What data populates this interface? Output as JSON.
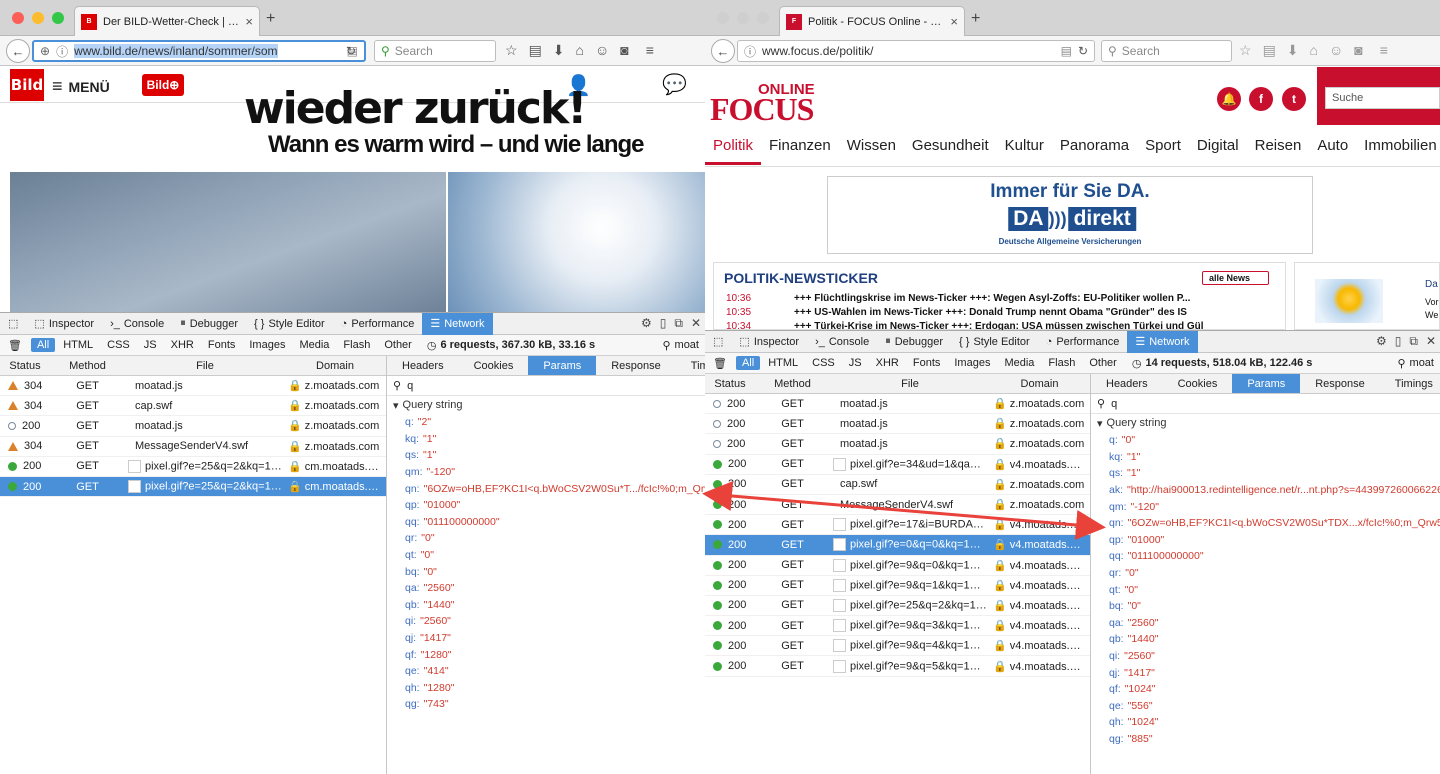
{
  "left": {
    "tab_title": "Der BILD-Wetter-Check | D...",
    "url": "www.bild.de/news/inland/sommer/som",
    "search_placeholder": "Search",
    "menu_label": "MENÜ",
    "logo": "Bild",
    "headline_cut": "wieder zurück!",
    "subheadline": "Wann es warm wird – und wie lange",
    "devtools": {
      "tabs": [
        "Inspector",
        "Console",
        "Debugger",
        "Style Editor",
        "Performance",
        "Network"
      ],
      "filters": [
        "All",
        "HTML",
        "CSS",
        "JS",
        "XHR",
        "Fonts",
        "Images",
        "Media",
        "Flash",
        "Other"
      ],
      "summary": "6 requests, 367.30 kB, 33.16 s",
      "filter_value": "moat",
      "headers": [
        "Status",
        "Method",
        "File",
        "Domain"
      ],
      "rows": [
        {
          "ind": "warn",
          "status": "304",
          "method": "GET",
          "file": "moatad.js",
          "domain": "z.moatads.com",
          "thumb": false
        },
        {
          "ind": "warn",
          "status": "304",
          "method": "GET",
          "file": "cap.swf",
          "domain": "z.moatads.com",
          "thumb": false
        },
        {
          "ind": "empty",
          "status": "200",
          "method": "GET",
          "file": "moatad.js",
          "domain": "z.moatads.com",
          "thumb": false
        },
        {
          "ind": "warn",
          "status": "304",
          "method": "GET",
          "file": "MessageSenderV4.swf",
          "domain": "z.moatads.com",
          "thumb": false
        },
        {
          "ind": "ok",
          "status": "200",
          "method": "GET",
          "file": "pixel.gif?e=25&q=2&kq=1&...",
          "domain": "cm.moatads.c...",
          "thumb": true
        },
        {
          "ind": "ok",
          "status": "200",
          "method": "GET",
          "file": "pixel.gif?e=25&q=2&kq=1&...",
          "domain": "cm.moatads.c...",
          "thumb": true,
          "selected": true
        }
      ],
      "side_tabs": [
        "Headers",
        "Cookies",
        "Params",
        "Response",
        "Timi"
      ],
      "param_filter": "q",
      "query_string_label": "Query string",
      "params": [
        {
          "k": "q:",
          "v": "\"2\""
        },
        {
          "k": "kq:",
          "v": "\"1\""
        },
        {
          "k": "qs:",
          "v": "\"1\""
        },
        {
          "k": "qm:",
          "v": "\"-120\""
        },
        {
          "k": "qn:",
          "v": "\"6OZw=oHB,EF?KC1I<q.bWoCSV2W0Su*T.../fcIc!%0;m_Qrw5.W/"
        },
        {
          "k": "qp:",
          "v": "\"01000\""
        },
        {
          "k": "qq:",
          "v": "\"011100000000\""
        },
        {
          "k": "qr:",
          "v": "\"0\""
        },
        {
          "k": "qt:",
          "v": "\"0\""
        },
        {
          "k": "bq:",
          "v": "\"0\""
        },
        {
          "k": "qa:",
          "v": "\"2560\""
        },
        {
          "k": "qb:",
          "v": "\"1440\""
        },
        {
          "k": "qi:",
          "v": "\"2560\""
        },
        {
          "k": "qj:",
          "v": "\"1417\""
        },
        {
          "k": "qf:",
          "v": "\"1280\""
        },
        {
          "k": "qe:",
          "v": "\"414\""
        },
        {
          "k": "qh:",
          "v": "\"1280\""
        },
        {
          "k": "qg:",
          "v": "\"743\""
        }
      ]
    }
  },
  "right": {
    "tab_title": "Politik - FOCUS Online - Na...",
    "url": "www.focus.de/politik/",
    "search_placeholder": "Search",
    "logo_online": "ONLINE",
    "logo_focus": "FOCUS",
    "suche": "Suche",
    "nav": [
      "Politik",
      "Finanzen",
      "Wissen",
      "Gesundheit",
      "Kultur",
      "Panorama",
      "Sport",
      "Digital",
      "Reisen",
      "Auto",
      "Immobilien"
    ],
    "ad": {
      "line1": "Immer für Sie DA.",
      "brand1": "DA",
      "brand2": "direkt",
      "line3": "Deutsche Allgemeine Versicherungen"
    },
    "newsticker": {
      "title": "POLITIK-NEWSTICKER",
      "all_news": "alle News",
      "items": [
        {
          "time": "10:36",
          "text": "+++ Flüchtlingskrise im News-Ticker +++: Wegen Asyl-Zoffs: EU-Politiker wollen P..."
        },
        {
          "time": "10:35",
          "text": "+++ US-Wahlen im News-Ticker +++: Donald Trump nennt Obama \"Gründer\" des IS"
        },
        {
          "time": "10:34",
          "text": "+++ Türkei-Krise im News-Ticker +++: Erdogan: USA müssen zwischen Türkei und Gül"
        }
      ]
    },
    "weather": {
      "t1": "Da",
      "t2": "Vor",
      "t3": "We"
    },
    "devtools": {
      "tabs": [
        "Inspector",
        "Console",
        "Debugger",
        "Style Editor",
        "Performance",
        "Network"
      ],
      "filters": [
        "All",
        "HTML",
        "CSS",
        "JS",
        "XHR",
        "Fonts",
        "Images",
        "Media",
        "Flash",
        "Other"
      ],
      "summary": "14 requests, 518.04 kB, 122.46 s",
      "filter_value": "moat",
      "headers": [
        "Status",
        "Method",
        "File",
        "Domain"
      ],
      "rows": [
        {
          "ind": "empty",
          "status": "200",
          "method": "GET",
          "file": "moatad.js",
          "domain": "z.moatads.com",
          "thumb": false
        },
        {
          "ind": "empty",
          "status": "200",
          "method": "GET",
          "file": "moatad.js",
          "domain": "z.moatads.com",
          "thumb": false
        },
        {
          "ind": "empty",
          "status": "200",
          "method": "GET",
          "file": "moatad.js",
          "domain": "z.moatads.com",
          "thumb": false
        },
        {
          "ind": "ok",
          "status": "200",
          "method": "GET",
          "file": "pixel.gif?e=34&ud=1&qa=25...",
          "domain": "v4.moatads.com",
          "thumb": true
        },
        {
          "ind": "ok",
          "status": "200",
          "method": "GET",
          "file": "cap.swf",
          "domain": "z.moatads.com",
          "thumb": false
        },
        {
          "ind": "ok",
          "status": "200",
          "method": "GET",
          "file": "MessageSenderV4.swf",
          "domain": "z.moatads.com",
          "thumb": false
        },
        {
          "ind": "ok",
          "status": "200",
          "method": "GET",
          "file": "pixel.gif?e=17&i=BURDAFOR...",
          "domain": "v4.moatads.com",
          "thumb": true
        },
        {
          "ind": "ok",
          "status": "200",
          "method": "GET",
          "file": "pixel.gif?e=0&q=0&kq=1&lo...",
          "domain": "v4.moatads.com",
          "thumb": true,
          "selected": true
        },
        {
          "ind": "ok",
          "status": "200",
          "method": "GET",
          "file": "pixel.gif?e=9&q=0&kq=1&lo...",
          "domain": "v4.moatads.com",
          "thumb": true
        },
        {
          "ind": "ok",
          "status": "200",
          "method": "GET",
          "file": "pixel.gif?e=9&q=1&kq=1&lo...",
          "domain": "v4.moatads.com",
          "thumb": true
        },
        {
          "ind": "ok",
          "status": "200",
          "method": "GET",
          "file": "pixel.gif?e=25&q=2&kq=1&...",
          "domain": "v4.moatads.com",
          "thumb": true
        },
        {
          "ind": "ok",
          "status": "200",
          "method": "GET",
          "file": "pixel.gif?e=9&q=3&kq=1&lo...",
          "domain": "v4.moatads.com",
          "thumb": true
        },
        {
          "ind": "ok",
          "status": "200",
          "method": "GET",
          "file": "pixel.gif?e=9&q=4&kq=1&lo...",
          "domain": "v4.moatads.com",
          "thumb": true
        },
        {
          "ind": "ok",
          "status": "200",
          "method": "GET",
          "file": "pixel.gif?e=9&q=5&kq=1&lo...",
          "domain": "v4.moatads.com",
          "thumb": true
        }
      ],
      "side_tabs": [
        "Headers",
        "Cookies",
        "Params",
        "Response",
        "Timings"
      ],
      "param_filter": "q",
      "query_string_label": "Query string",
      "params": [
        {
          "k": "q:",
          "v": "\"0\""
        },
        {
          "k": "kq:",
          "v": "\"1\""
        },
        {
          "k": "qs:",
          "v": "\"1\""
        },
        {
          "k": "ak:",
          "v": "\"http://hai900013.redintelligence.net/r...nt.php?s=443997260066226"
        },
        {
          "k": "qm:",
          "v": "\"-120\""
        },
        {
          "k": "qn:",
          "v": "\"6OZw=oHB,EF?KC1I<q.bWoCSV2W0Su*TDX...x/fcIc!%0;m_Qrw5.W/L"
        },
        {
          "k": "qp:",
          "v": "\"01000\""
        },
        {
          "k": "qq:",
          "v": "\"011100000000\""
        },
        {
          "k": "qr:",
          "v": "\"0\""
        },
        {
          "k": "qt:",
          "v": "\"0\""
        },
        {
          "k": "bq:",
          "v": "\"0\""
        },
        {
          "k": "qa:",
          "v": "\"2560\""
        },
        {
          "k": "qb:",
          "v": "\"1440\""
        },
        {
          "k": "qi:",
          "v": "\"2560\""
        },
        {
          "k": "qj:",
          "v": "\"1417\""
        },
        {
          "k": "qf:",
          "v": "\"1024\""
        },
        {
          "k": "qe:",
          "v": "\"556\""
        },
        {
          "k": "qh:",
          "v": "\"1024\""
        },
        {
          "k": "qg:",
          "v": "\"885\""
        }
      ]
    }
  },
  "colors": {
    "accent": "#4a90d9",
    "bild_red": "#dd0000",
    "focus_red": "#c8102e",
    "arrow": "#e8423a"
  }
}
